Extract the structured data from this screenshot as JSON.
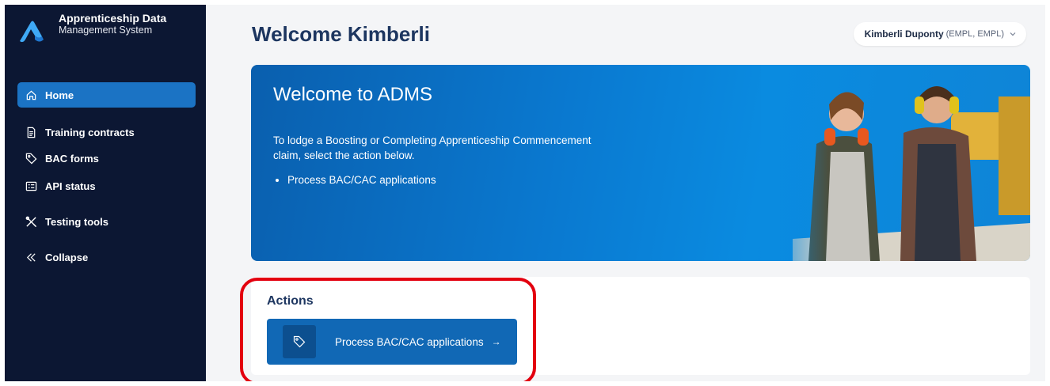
{
  "app": {
    "title_line1": "Apprenticeship Data",
    "title_line2": "Management System"
  },
  "sidebar": {
    "items": [
      {
        "label": "Home",
        "icon": "home-icon",
        "active": true
      },
      {
        "label": "Training contracts",
        "icon": "document-icon"
      },
      {
        "label": "BAC forms",
        "icon": "tag-icon"
      },
      {
        "label": "API status",
        "icon": "status-list-icon"
      },
      {
        "label": "Testing tools",
        "icon": "tools-icon"
      },
      {
        "label": "Collapse",
        "icon": "double-chevron-left-icon"
      }
    ]
  },
  "header": {
    "title": "Welcome Kimberli",
    "user_name": "Kimberli Duponty",
    "user_roles": "(EMPL, EMPL)"
  },
  "hero": {
    "title": "Welcome to ADMS",
    "text": "To lodge a Boosting or Completing Apprenticeship Commencement claim, select the action below.",
    "list": [
      "Process BAC/CAC applications"
    ]
  },
  "actions": {
    "title": "Actions",
    "items": [
      {
        "label": "Process BAC/CAC applications",
        "arrow": "→",
        "icon": "tag-icon"
      }
    ]
  },
  "colors": {
    "sidebar_bg": "#0c1733",
    "active_item": "#1b73c4",
    "title_text": "#1d3660",
    "action_button": "#1168b5",
    "highlight": "#e3000f"
  }
}
